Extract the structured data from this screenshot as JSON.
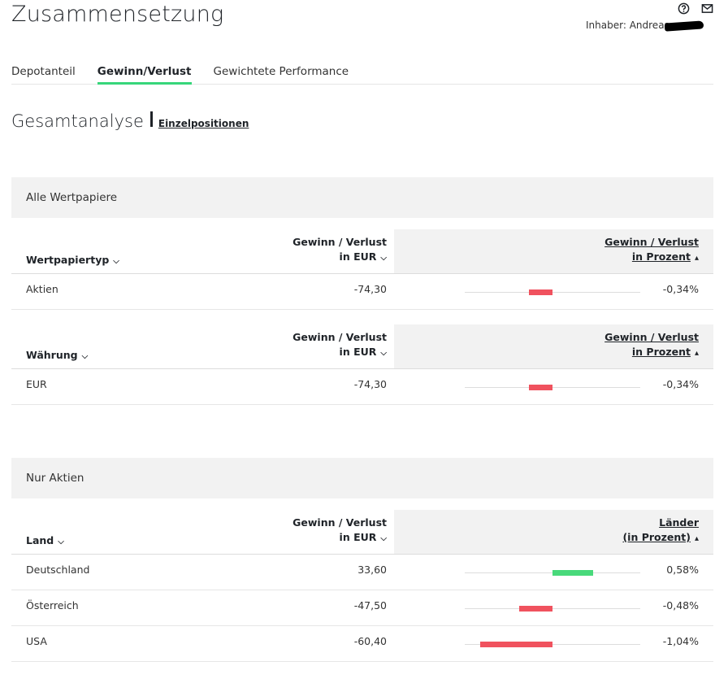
{
  "header": {
    "title": "Zusammensetzung",
    "owner_label": "Inhaber:",
    "owner_name": "Andreas",
    "icons": [
      "help-icon",
      "mail-icon"
    ]
  },
  "tabs": [
    {
      "label": "Depotanteil",
      "active": false
    },
    {
      "label": "Gewinn/Verlust",
      "active": true
    },
    {
      "label": "Gewichtete Performance",
      "active": false
    }
  ],
  "subheader": {
    "title": "Gesamtanalyse",
    "link": "Einzelpositionen"
  },
  "colors": {
    "negative": "#f0525e",
    "positive": "#48d97b",
    "accent": "#37d67a"
  },
  "sections": [
    {
      "title": "Alle Wertpapiere",
      "tables": [
        {
          "col1": "Wertpapiertyp",
          "col2_line1": "Gewinn / Verlust",
          "col2_line2": "in EUR",
          "col3_line1": "Gewinn / Verlust",
          "col3_line2": "in Prozent",
          "rows": [
            {
              "name": "Aktien",
              "value": "-74,30",
              "percent": "-0,34%",
              "pct": -0.34
            }
          ]
        },
        {
          "col1": "Währung",
          "col2_line1": "Gewinn / Verlust",
          "col2_line2": "in EUR",
          "col3_line1": "Gewinn / Verlust",
          "col3_line2": "in Prozent",
          "rows": [
            {
              "name": "EUR",
              "value": "-74,30",
              "percent": "-0,34%",
              "pct": -0.34
            }
          ]
        }
      ]
    },
    {
      "title": "Nur Aktien",
      "tables": [
        {
          "col1": "Land",
          "col2_line1": "Gewinn / Verlust",
          "col2_line2": "in EUR",
          "col3_line1": "Länder",
          "col3_line2": "(in Prozent)",
          "rows": [
            {
              "name": "Deutschland",
              "value": "33,60",
              "percent": "0,58%",
              "pct": 0.58
            },
            {
              "name": "Österreich",
              "value": "-47,50",
              "percent": "-0,48%",
              "pct": -0.48
            },
            {
              "name": "USA",
              "value": "-60,40",
              "percent": "-1,04%",
              "pct": -1.04
            }
          ]
        }
      ]
    }
  ]
}
